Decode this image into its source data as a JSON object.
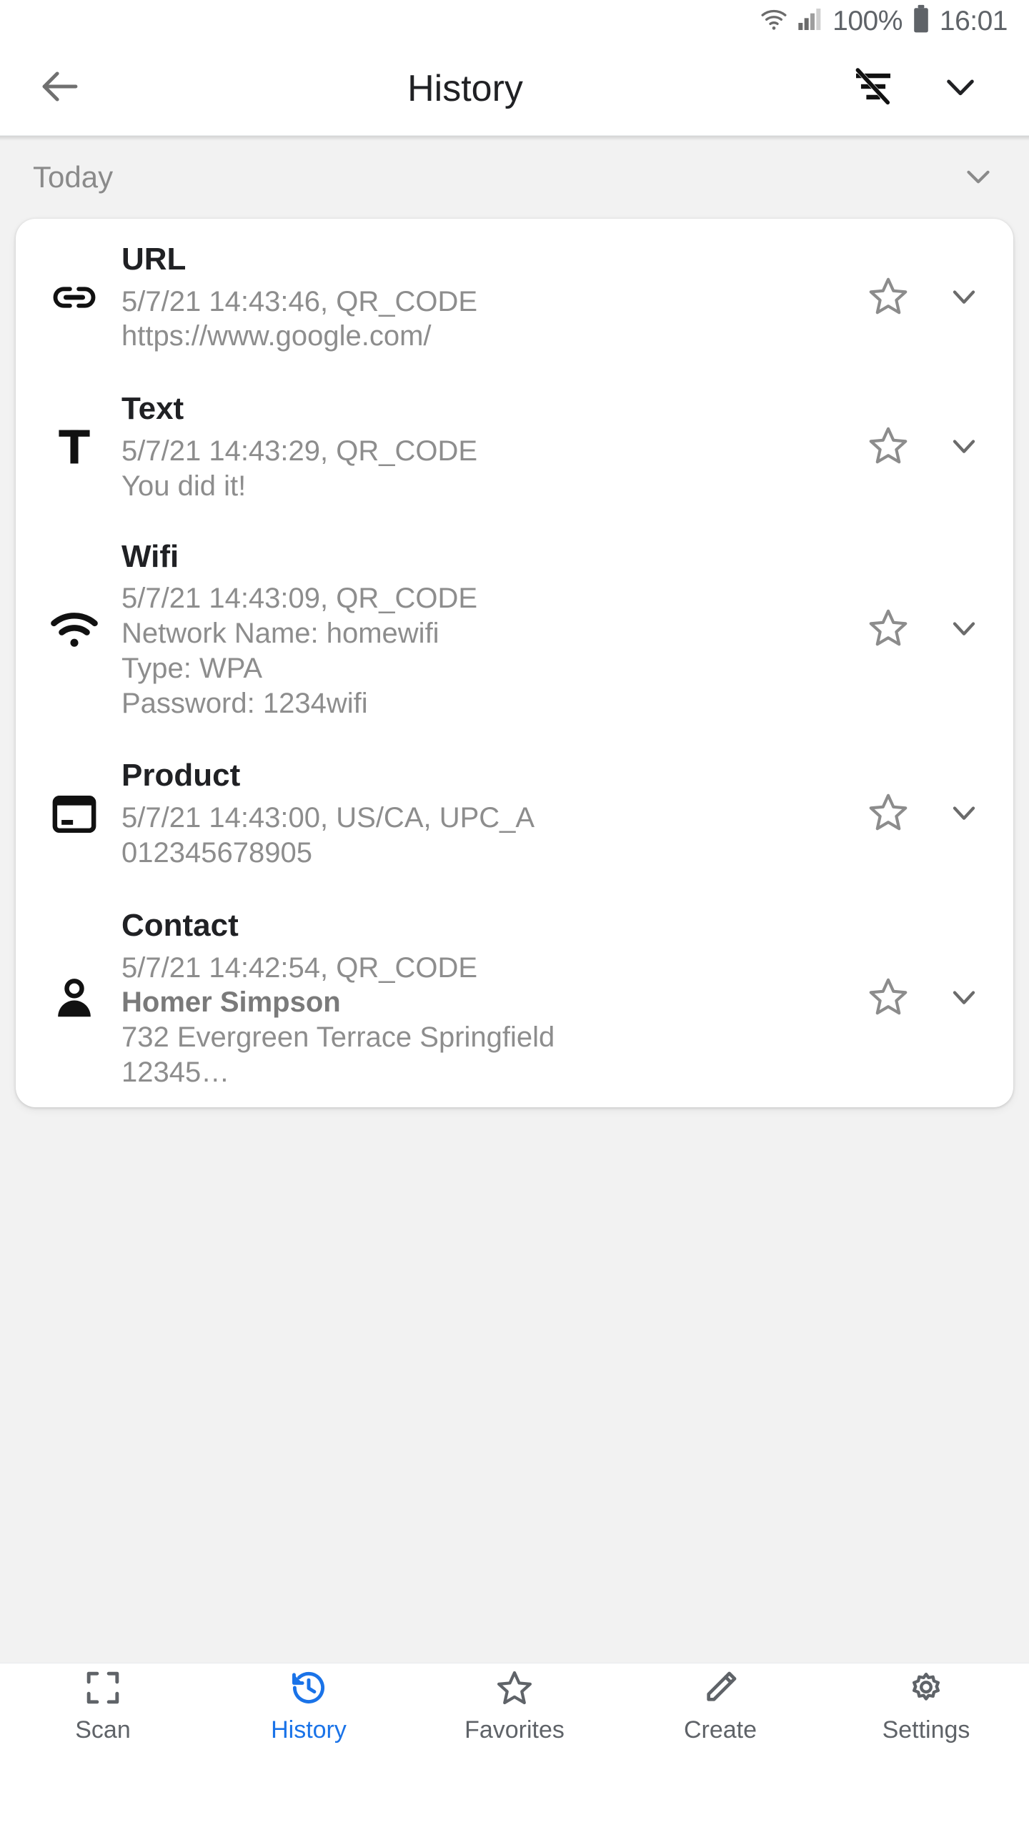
{
  "status_bar": {
    "wifi_icon": "wifi-icon",
    "signal_icon": "cellular-signal-icon",
    "battery_percent": "100%",
    "battery_icon": "battery-full-icon",
    "time": "16:01"
  },
  "app_bar": {
    "back_icon": "back-arrow-icon",
    "title": "History",
    "filter_off_icon": "sort-filter-off-icon",
    "expand_icon": "chevron-down-icon"
  },
  "group": {
    "label": "Today",
    "collapse_icon": "chevron-down-icon"
  },
  "colors": {
    "accent": "#1a73e8",
    "title_text": "#202124",
    "secondary_text": "#8d8d8d",
    "page_bg": "#f2f2f2",
    "card_bg": "#ffffff"
  },
  "history_items": [
    {
      "icon": "link-icon",
      "title": "URL",
      "meta": "5/7/21 14:43:46, QR_CODE",
      "lines": [
        "https://www.google.com/"
      ],
      "favorite_icon": "star-outline-icon",
      "expand_icon": "chevron-down-icon"
    },
    {
      "icon": "text-icon",
      "title": "Text",
      "meta": "5/7/21 14:43:29, QR_CODE",
      "lines": [
        "You did it!"
      ],
      "favorite_icon": "star-outline-icon",
      "expand_icon": "chevron-down-icon"
    },
    {
      "icon": "wifi-icon",
      "title": "Wifi",
      "meta": "5/7/21 14:43:09, QR_CODE",
      "lines": [
        "Network Name: homewifi",
        "Type: WPA",
        "Password: 1234wifi"
      ],
      "favorite_icon": "star-outline-icon",
      "expand_icon": "chevron-down-icon"
    },
    {
      "icon": "product-card-icon",
      "title": "Product",
      "meta": "5/7/21 14:43:00, US/CA, UPC_A",
      "lines": [
        "012345678905"
      ],
      "favorite_icon": "star-outline-icon",
      "expand_icon": "chevron-down-icon"
    },
    {
      "icon": "person-icon",
      "title": "Contact",
      "meta": "5/7/21 14:42:54, QR_CODE",
      "lines": [
        "Homer Simpson",
        "732 Evergreen Terrace Springfield",
        "12345…"
      ],
      "favorite_icon": "star-outline-icon",
      "expand_icon": "chevron-down-icon"
    }
  ],
  "bottom_nav": {
    "items": [
      {
        "label": "Scan",
        "icon": "scan-frame-icon",
        "active": false
      },
      {
        "label": "History",
        "icon": "history-clock-icon",
        "active": true
      },
      {
        "label": "Favorites",
        "icon": "star-outline-icon",
        "active": false
      },
      {
        "label": "Create",
        "icon": "pencil-icon",
        "active": false
      },
      {
        "label": "Settings",
        "icon": "gear-icon",
        "active": false
      }
    ]
  }
}
